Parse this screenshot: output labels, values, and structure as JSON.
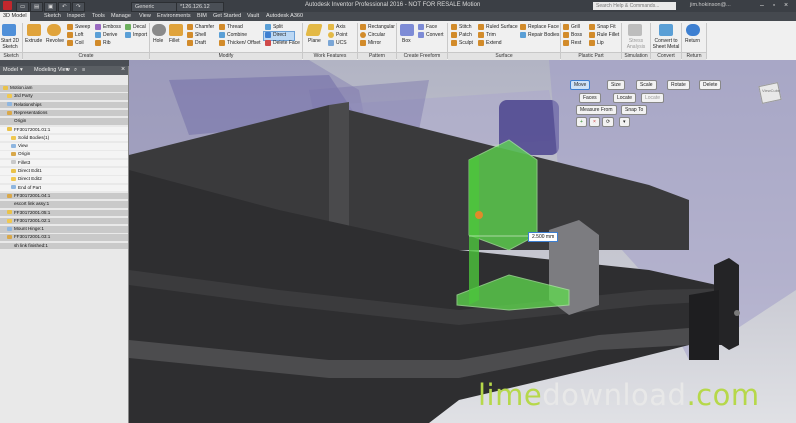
{
  "titlebar": {
    "title": "Autodesk Inventor Professional 2016 - NOT FOR RESALE  Motion",
    "material": "Generic",
    "appearance": "*126.126.12",
    "search_placeholder": "Search Help & Commands...",
    "user": "jim.hokinson@..."
  },
  "tabs": [
    "3D Model",
    "Sketch",
    "Inspect",
    "Tools",
    "Manage",
    "View",
    "Environments",
    "BIM",
    "Get Started",
    "Vault",
    "Autodesk A360"
  ],
  "ribbon": {
    "start_sketch": "Start 2D Sketch",
    "sketch_panel": "Sketch",
    "create": {
      "extrude": "Extrude",
      "revolve": "Revolve",
      "sweep": "Sweep",
      "loft": "Loft",
      "coil": "Coil",
      "emboss": "Emboss",
      "derive": "Derive",
      "rib": "Rib",
      "decal": "Decal",
      "import": "Import",
      "title": "Create"
    },
    "modify": {
      "hole": "Hole",
      "fillet": "Fillet",
      "chamfer": "Chamfer",
      "shell": "Shell",
      "draft": "Draft",
      "thread": "Thread",
      "combine": "Combine",
      "thicken": "Thicken/ Offset",
      "split": "Split",
      "direct": "Direct",
      "delete_face": "Delete Face",
      "title": "Modify"
    },
    "work": {
      "plane": "Plane",
      "axis": "Axis",
      "point": "Point",
      "ucs": "UCS",
      "title": "Work Features"
    },
    "pattern": {
      "rectangular": "Rectangular",
      "circular": "Circular",
      "mirror": "Mirror",
      "title": "Pattern"
    },
    "freeform": {
      "box": "Box",
      "face": "Face",
      "convert": "Convert",
      "title": "Create Freeform"
    },
    "surface": {
      "stitch": "Stitch",
      "patch": "Patch",
      "sculpt": "Sculpt",
      "ruled": "Ruled Surface",
      "trim": "Trim",
      "extend": "Extend",
      "replace": "Replace Face",
      "repair": "Repair Bodies",
      "title": "Surface"
    },
    "plastic": {
      "grill": "Grill",
      "rest": "Rest",
      "snap_fit": "Snap Fit",
      "rule_fillet": "Rule Fillet",
      "lip": "Lip",
      "boss": "Boss",
      "title": "Plastic Part"
    },
    "simulation": {
      "stress": "Stress Analysis",
      "title": "Simulation"
    },
    "convert": {
      "sheet_metal": "Convert to Sheet Metal",
      "title": "Convert"
    },
    "return": {
      "label": "Return",
      "title": "Return"
    }
  },
  "browser": {
    "title": "Model",
    "view": "Modeling View",
    "items": [
      {
        "label": "Motion.iam",
        "indent": 0,
        "shaded": true
      },
      {
        "label": "3rd Party",
        "indent": 1,
        "shaded": true
      },
      {
        "label": "Relationships",
        "indent": 1,
        "shaded": true
      },
      {
        "label": "Representations",
        "indent": 1,
        "shaded": true
      },
      {
        "label": "Origin",
        "indent": 1,
        "shaded": true
      },
      {
        "label": "FF30172001.01:1",
        "indent": 1,
        "shaded": false
      },
      {
        "label": "Solid Bodies(1)",
        "indent": 2,
        "shaded": false
      },
      {
        "label": "View",
        "indent": 2,
        "shaded": false
      },
      {
        "label": "Origin",
        "indent": 2,
        "shaded": false
      },
      {
        "label": "Fillet3",
        "indent": 2,
        "shaded": false
      },
      {
        "label": "Direct Edit1",
        "indent": 2,
        "shaded": false
      },
      {
        "label": "Direct Edit2",
        "indent": 2,
        "shaded": false
      },
      {
        "label": "End of Part",
        "indent": 2,
        "shaded": false
      },
      {
        "label": "FF30172001.04:1",
        "indent": 1,
        "shaded": true
      },
      {
        "label": "escort link assy:1",
        "indent": 1,
        "shaded": true
      },
      {
        "label": "FF30172001.05:1",
        "indent": 1,
        "shaded": true
      },
      {
        "label": "FF30172001.02:1",
        "indent": 1,
        "shaded": true
      },
      {
        "label": "Mount Hinge:1",
        "indent": 1,
        "shaded": true
      },
      {
        "label": "FF30172001.03:1",
        "indent": 1,
        "shaded": true
      },
      {
        "label": "sh link finished:1",
        "indent": 1,
        "shaded": true
      }
    ]
  },
  "viewport": {
    "toolbar1": [
      "Move",
      "Size",
      "Scale",
      "Rotate",
      "Delete"
    ],
    "toolbar2": [
      "Faces",
      "Locate",
      "Locate"
    ],
    "toolbar3": [
      "Measure From",
      "Snap To"
    ],
    "dimension": "2.500 mm",
    "viewcube": "ViewCube"
  },
  "watermark": {
    "lime": "lime",
    "download": "download",
    "com": ".com"
  },
  "colors": {
    "accent": "#3d7fd1",
    "selection": "#58e04a",
    "watermark_lime": "#b6d84a",
    "watermark_white": "#e8e8e8"
  }
}
